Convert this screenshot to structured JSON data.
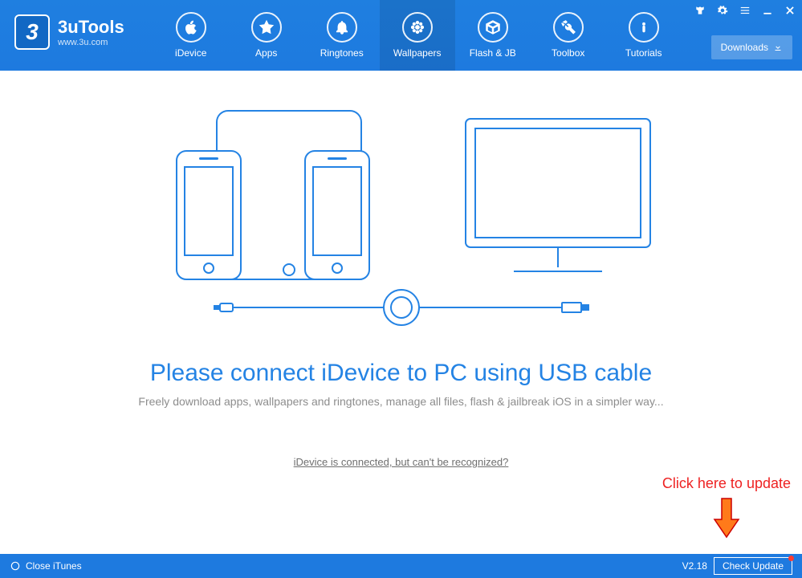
{
  "brand": {
    "title": "3uTools",
    "url": "www.3u.com",
    "logo_char": "3"
  },
  "nav": [
    {
      "key": "idevice",
      "label": "iDevice"
    },
    {
      "key": "apps",
      "label": "Apps"
    },
    {
      "key": "ringtones",
      "label": "Ringtones"
    },
    {
      "key": "wallpapers",
      "label": "Wallpapers",
      "active": true
    },
    {
      "key": "flashjb",
      "label": "Flash & JB"
    },
    {
      "key": "toolbox",
      "label": "Toolbox"
    },
    {
      "key": "tutorials",
      "label": "Tutorials"
    }
  ],
  "header_buttons": {
    "downloads": "Downloads"
  },
  "main": {
    "headline": "Please connect iDevice to PC using USB cable",
    "subline": "Freely download apps, wallpapers and ringtones, manage all files, flash & jailbreak iOS in a simpler way...",
    "help_link": "iDevice is connected, but can't be recognized?"
  },
  "callout": {
    "text": "Click here to update"
  },
  "footer": {
    "close_itunes": "Close iTunes",
    "version": "V2.18",
    "check_update": "Check Update"
  }
}
